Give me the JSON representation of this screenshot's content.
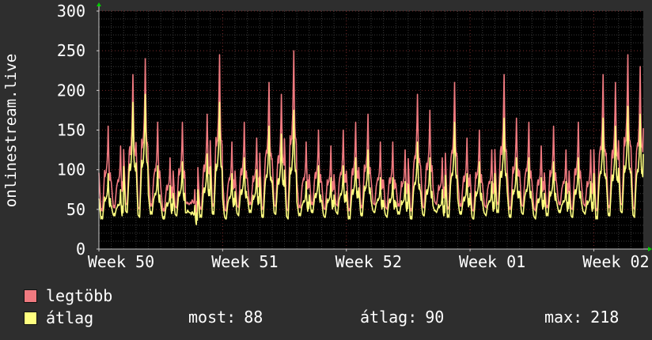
{
  "chart_data": {
    "type": "line",
    "ylabel": "onlinestream.live",
    "ylim": [
      0,
      300
    ],
    "y_ticks": [
      0,
      50,
      100,
      150,
      200,
      250,
      300
    ],
    "x_ticks": [
      "Week 50",
      "Week 51",
      "Week 52",
      "Week 01",
      "Week 02"
    ],
    "grid": true,
    "x_range_days": [
      0,
      44
    ],
    "x_tick_positions_days": [
      0,
      10,
      20,
      30,
      40
    ],
    "series": [
      {
        "name": "legtöbb",
        "color": "#f07a80",
        "daily_peaks": [
          155,
          130,
          220,
          240,
          160,
          115,
          160,
          75,
          170,
          245,
          135,
          160,
          140,
          210,
          195,
          250,
          135,
          150,
          130,
          150,
          160,
          170,
          135,
          135,
          125,
          195,
          175,
          115,
          210,
          140,
          150,
          125,
          220,
          165,
          160,
          130,
          155,
          125,
          160,
          125,
          220,
          210,
          245,
          230,
          280,
          220
        ]
      },
      {
        "name": "átlag",
        "color": "#ffff80",
        "daily_peaks": [
          95,
          75,
          185,
          195,
          105,
          80,
          110,
          55,
          120,
          185,
          95,
          115,
          100,
          155,
          145,
          175,
          85,
          105,
          90,
          105,
          115,
          125,
          90,
          90,
          85,
          135,
          115,
          75,
          160,
          95,
          110,
          85,
          165,
          115,
          115,
          90,
          110,
          85,
          115,
          85,
          165,
          155,
          180,
          170,
          220,
          160
        ]
      }
    ]
  },
  "legend": [
    {
      "label": "legtöbb",
      "color": "#f07a80"
    },
    {
      "label": "átlag",
      "color": "#ffff80"
    }
  ],
  "stats": {
    "current_label": "most:",
    "current_value": "88",
    "average_label": "átlag:",
    "average_value": "90",
    "max_label": "max:",
    "max_value": "218"
  }
}
